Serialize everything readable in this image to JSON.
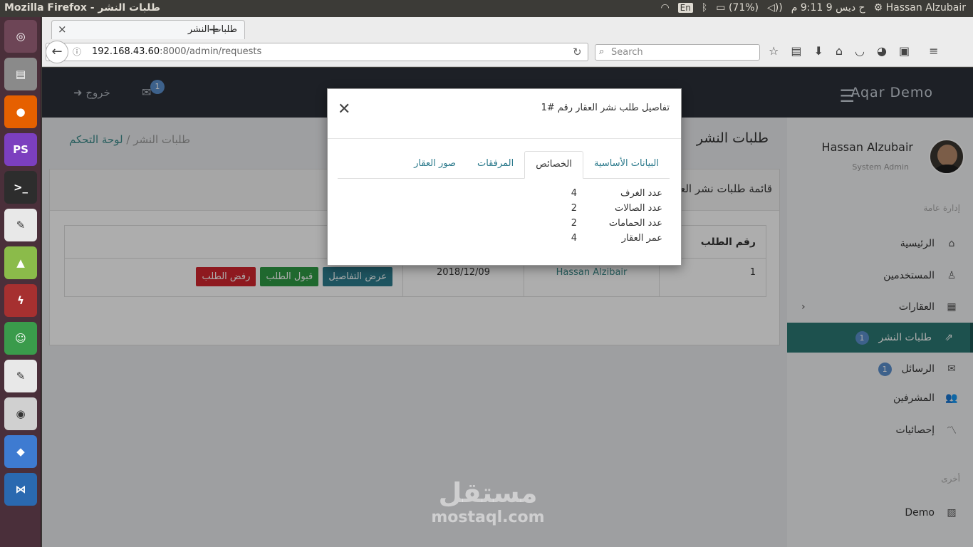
{
  "os": {
    "window_title": "Mozilla Firefox - طلبات النشر",
    "lang": "En",
    "battery": "(71%)",
    "clock": "ح ديس 9 9:11 م",
    "user": "Hassan Alzubair"
  },
  "launcher": [
    "ubuntu",
    "files",
    "firefox",
    "phpstorm",
    "terminal",
    "text-editor",
    "android-studio",
    "filezilla",
    "image-app",
    "gedit",
    "camera",
    "virtualbox",
    "vscode",
    "stack"
  ],
  "browser": {
    "tab_title": "طلبات النشر",
    "url_host": "192.168.43.60",
    "url_path": ":8000/admin/requests",
    "search_placeholder": "Search"
  },
  "app": {
    "brand": "Aqar Demo",
    "logout": "خروج",
    "mail_count": "1",
    "page_title": "طلبات النشر",
    "breadcrumb_home": "لوحة التحكم",
    "breadcrumb_sep": " /",
    "breadcrumb_current": "طلبات النشر",
    "card_title": "قائمة طلبات نشر العقارات",
    "table": {
      "headers": [
        "رقم الطلب",
        "",
        "",
        ""
      ],
      "row": {
        "id": "1",
        "user": "Hassan Alzibair",
        "date": "2018/12/09",
        "view": "عرض التفاصيل",
        "accept": "قبول الطلب",
        "reject": "رفض الطلب"
      }
    },
    "sidebar": {
      "name": "Hassan Alzubair",
      "role": "System Admin",
      "section_main": "إدارة عامة",
      "section_other": "أخرى",
      "items": [
        {
          "label": "الرئيسية",
          "icon": "home-icon"
        },
        {
          "label": "المستخدمين",
          "icon": "user-icon"
        },
        {
          "label": "العقارات",
          "icon": "building-icon"
        },
        {
          "label": "طلبات النشر",
          "icon": "share-icon",
          "badge": "1"
        },
        {
          "label": "الرسائل",
          "icon": "envelope-icon",
          "badge": "1"
        },
        {
          "label": "المشرفين",
          "icon": "users-icon"
        },
        {
          "label": "إحصائيات",
          "icon": "chart-icon"
        }
      ],
      "demo": "Demo"
    }
  },
  "modal": {
    "title": "تفاصيل طلب نشر العقار رقم #1",
    "tabs": [
      "البيانات الأساسية",
      "الخصائص",
      "المرفقات",
      "صور العقار"
    ],
    "active_tab": "الخصائص",
    "props": [
      {
        "label": "عدد الغرف",
        "value": "4"
      },
      {
        "label": "عدد الصالات",
        "value": "2"
      },
      {
        "label": "عدد الحمامات",
        "value": "2"
      },
      {
        "label": "عمر العقار",
        "value": "4"
      }
    ]
  },
  "watermark": {
    "ar": "مستقل",
    "en": "mostaql.com"
  }
}
